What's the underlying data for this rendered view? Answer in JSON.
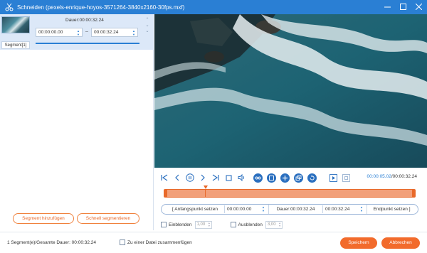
{
  "window": {
    "title": "Schneiden (pexels-enrique-hoyos-3571264-3840x2160-30fps.mxf)"
  },
  "segment_panel": {
    "duration_label": "Dauer:00:00:32.24",
    "start_time": "00:00:00.00",
    "end_time": "00:00:32.24",
    "separator": "–",
    "segment_tab": "Segment[1]"
  },
  "left_buttons": {
    "add_segment": "Segment hinzufügen",
    "quick_split": "Schnell segmentieren"
  },
  "player": {
    "current_time": "00:00:05.02",
    "total_time": "/00:00:32.24",
    "progress": 0.156
  },
  "trim_row": {
    "set_start": "Anfangspunkt setzen",
    "start_value": "00:00:00.00",
    "duration": "Dauer:00:00:32.24",
    "end_value": "00:00:32.24",
    "set_end": "Endpunkt setzen"
  },
  "fade": {
    "fade_in_label": "Einblenden",
    "fade_in_value": "1,00",
    "fade_out_label": "Ausblenden",
    "fade_out_value": "3,00"
  },
  "footer": {
    "info": "1 Segment(e)/Gesamte Dauer: 00:00:32.24",
    "merge_label": "Zu einer Datei zusammenfügen",
    "save": "Speichern",
    "cancel": "Abbrechen"
  },
  "colors": {
    "titlebar": "#2a7fd4",
    "accent": "#f26b2c"
  }
}
